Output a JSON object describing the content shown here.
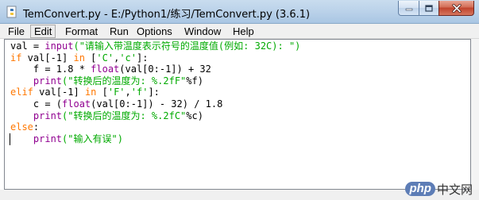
{
  "window": {
    "title": "TemConvert.py - E:/Python1/练习/TemConvert.py (3.6.1)"
  },
  "menu": {
    "items": [
      {
        "label": "File",
        "active": false
      },
      {
        "label": "Edit",
        "active": true
      },
      {
        "label": "Format",
        "active": false
      },
      {
        "label": "Run",
        "active": false
      },
      {
        "label": "Options",
        "active": false
      },
      {
        "label": "Window",
        "active": false
      },
      {
        "label": "Help",
        "active": false
      }
    ]
  },
  "code": {
    "lines": [
      [
        {
          "t": "val = "
        },
        {
          "t": "input",
          "c": "bi"
        },
        {
          "t": "(\"请输入带温度表示符号的温度值(例如: 32C): \")",
          "c": "str"
        }
      ],
      [
        {
          "t": "if",
          "c": "kw"
        },
        {
          "t": " val[-1] "
        },
        {
          "t": "in",
          "c": "kw"
        },
        {
          "t": " ["
        },
        {
          "t": "'C'",
          "c": "str"
        },
        {
          "t": ","
        },
        {
          "t": "'c'",
          "c": "str"
        },
        {
          "t": "]:"
        }
      ],
      [
        {
          "t": "    f = 1.8 * "
        },
        {
          "t": "float",
          "c": "bi"
        },
        {
          "t": "(val[0:-1]) + 32"
        }
      ],
      [
        {
          "t": "    "
        },
        {
          "t": "print",
          "c": "bi"
        },
        {
          "t": "(\"转换后的温度为: %.2fF\"",
          "c": "str"
        },
        {
          "t": "%f)"
        }
      ],
      [
        {
          "t": "elif",
          "c": "kw"
        },
        {
          "t": " val[-1] "
        },
        {
          "t": "in",
          "c": "kw"
        },
        {
          "t": " ["
        },
        {
          "t": "'F'",
          "c": "str"
        },
        {
          "t": ","
        },
        {
          "t": "'f'",
          "c": "str"
        },
        {
          "t": "]:"
        }
      ],
      [
        {
          "t": "    c = ("
        },
        {
          "t": "float",
          "c": "bi"
        },
        {
          "t": "(val[0:-1]) - 32) / 1.8"
        }
      ],
      [
        {
          "t": "    "
        },
        {
          "t": "print",
          "c": "bi"
        },
        {
          "t": "(\"转换后的温度为: %.2fC\"",
          "c": "str"
        },
        {
          "t": "%c)"
        }
      ],
      [
        {
          "t": "else",
          "c": "kw"
        },
        {
          "t": ":"
        }
      ],
      [
        {
          "t": "    "
        },
        {
          "t": "print",
          "c": "bi"
        },
        {
          "t": "(\"输入有误\")",
          "c": "str"
        }
      ]
    ]
  },
  "watermark": {
    "logo": "php",
    "text": "中文网"
  },
  "colors": {
    "keyword": "#ff7700",
    "builtin": "#900090",
    "string": "#00aa00",
    "close_button": "#c0432c"
  },
  "icons": [
    "python-file-icon",
    "minimize-icon",
    "maximize-icon",
    "close-icon"
  ]
}
